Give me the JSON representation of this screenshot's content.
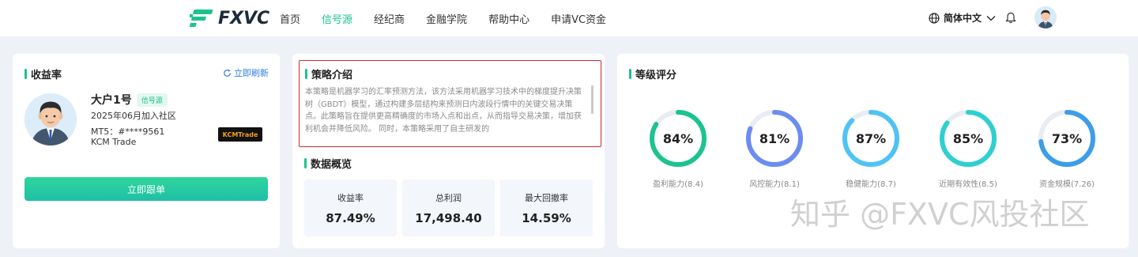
{
  "header": {
    "logo_text": "FXVC",
    "nav": [
      "首页",
      "信号源",
      "经纪商",
      "金融学院",
      "帮助中心",
      "申请VC资金"
    ],
    "active_nav": "信号源",
    "language": "简体中文",
    "accent": "#1cc38e"
  },
  "returns_card": {
    "title": "收益率",
    "refresh_label": "立即刷新",
    "user_name": "大户1号",
    "badge": "信号源",
    "joined": "2025年06月加入社区",
    "mt5": "MT5：#****9561",
    "broker": "KCM Trade",
    "broker_logo_text": "KCMTrade",
    "follow_button": "立即跟单"
  },
  "strategy": {
    "title": "策略介绍",
    "text": "本策略是机器学习的汇率预测方法，该方法采用机器学习技术中的梯度提升决策树（GBDT）模型，通过构建多层结构来预测日内波段行情中的关键交易决策点。此策略旨在提供更高精确度的市场入点和出点，从而指导交易决策，增加获利机会并降低风险。 同时，本策略采用了自主研发的"
  },
  "overview": {
    "title": "数据概览",
    "stats": [
      {
        "label": "收益率",
        "value": "87.49%"
      },
      {
        "label": "总利润",
        "value": "17,498.40"
      },
      {
        "label": "最大回撤率",
        "value": "14.59%"
      }
    ]
  },
  "rating": {
    "title": "等级评分",
    "gauges": [
      {
        "value": "84%",
        "pct": 84,
        "label": "盈利能力(8.4)",
        "color": "#1cc38e"
      },
      {
        "value": "81%",
        "pct": 81,
        "label": "风控能力(8.1)",
        "color": "#6b8cf0"
      },
      {
        "value": "87%",
        "pct": 87,
        "label": "稳健能力(8.7)",
        "color": "#4fc3f2"
      },
      {
        "value": "85%",
        "pct": 85,
        "label": "近期有效性(8.5)",
        "color": "#2fcfd0"
      },
      {
        "value": "73%",
        "pct": 73,
        "label": "资金规模(7.26)",
        "color": "#3d9de8"
      }
    ]
  },
  "watermark": "知乎 @FXVC风投社区"
}
